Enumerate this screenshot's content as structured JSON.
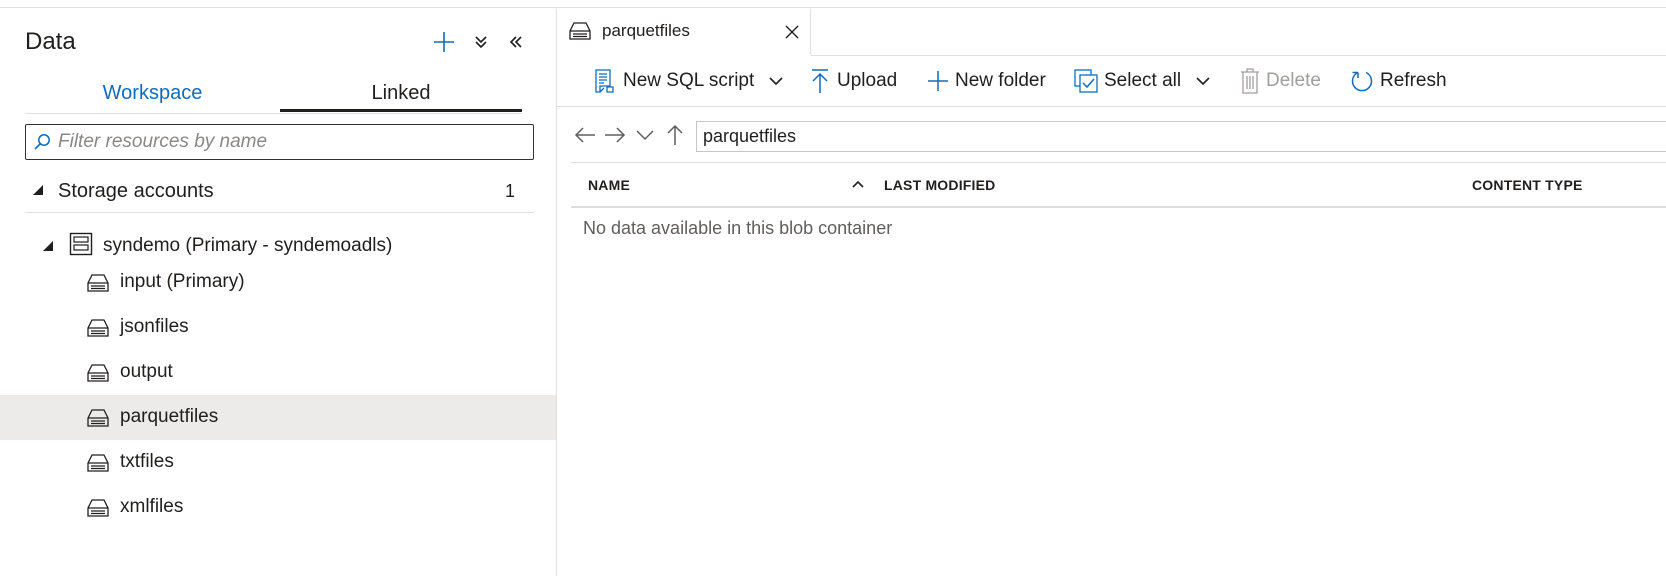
{
  "panel": {
    "title": "Data",
    "tabs": [
      {
        "label": "Workspace",
        "selected": false
      },
      {
        "label": "Linked",
        "selected": true
      }
    ],
    "filter_placeholder": "Filter resources by name",
    "section": {
      "label": "Storage accounts",
      "count": "1"
    },
    "account": {
      "label": "syndemo (Primary - syndemoadls)"
    },
    "containers": [
      {
        "label": "input (Primary)",
        "selected": false
      },
      {
        "label": "jsonfiles",
        "selected": false
      },
      {
        "label": "output",
        "selected": false
      },
      {
        "label": "parquetfiles",
        "selected": true
      },
      {
        "label": "txtfiles",
        "selected": false
      },
      {
        "label": "xmlfiles",
        "selected": false
      }
    ]
  },
  "editor": {
    "tab": {
      "label": "parquetfiles"
    },
    "toolbar": {
      "new_sql_script": "New SQL script",
      "upload": "Upload",
      "new_folder": "New folder",
      "select_all": "Select all",
      "delete": "Delete",
      "refresh": "Refresh"
    },
    "path": "parquetfiles",
    "columns": {
      "name": "NAME",
      "last_modified": "LAST MODIFIED",
      "content_type": "CONTENT TYPE"
    },
    "empty_message": "No data available in this blob container"
  },
  "colors": {
    "accent": "#0f6cbd",
    "selected_row": "#edebe9",
    "border": "#e1dfdd"
  },
  "icons": {
    "add": "plus-icon",
    "expand_all": "double-chevron-down-icon",
    "collapse_panel": "double-chevron-left-icon",
    "search": "search-icon",
    "container": "container-icon",
    "storage": "storage-account-icon"
  }
}
